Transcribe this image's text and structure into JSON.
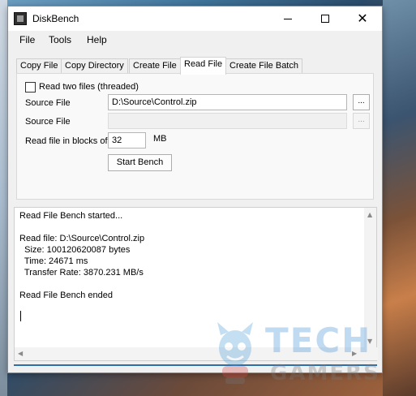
{
  "window": {
    "title": "DiskBench"
  },
  "controls": {
    "minimize_icon": "minimize-icon",
    "maximize_icon": "maximize-icon",
    "close_icon": "close-icon"
  },
  "menu": {
    "items": [
      {
        "label": "File"
      },
      {
        "label": "Tools"
      },
      {
        "label": "Help"
      }
    ]
  },
  "tabs": [
    {
      "label": "Copy File",
      "active": false
    },
    {
      "label": "Copy Directory",
      "active": false
    },
    {
      "label": "Create File",
      "active": false
    },
    {
      "label": "Read File",
      "active": true
    },
    {
      "label": "Create File Batch",
      "active": false
    }
  ],
  "form": {
    "read_two_files_label": "Read two files (threaded)",
    "read_two_files_checked": false,
    "source_file_label_1": "Source File",
    "source_file_value_1": "D:\\Source\\Control.zip",
    "source_file_label_2": "Source File",
    "source_file_value_2": "",
    "browse_label": "...",
    "block_size_label": "Read file in blocks of",
    "block_size_value": "32",
    "block_size_unit": "MB",
    "start_button_label": "Start Bench"
  },
  "output": {
    "lines": [
      "Read File Bench started...",
      "",
      "Read file: D:\\Source\\Control.zip",
      "  Size: 100120620087 bytes",
      "  Time: 24671 ms",
      "  Transfer Rate: 3870.231 MB/s",
      "",
      "Read File Bench ended"
    ]
  },
  "watermark": {
    "line1": "TECH",
    "line2": "GAMERS"
  },
  "colors": {
    "accent": "#2d6fa8",
    "watermark_blue": "#3e8fd6"
  }
}
